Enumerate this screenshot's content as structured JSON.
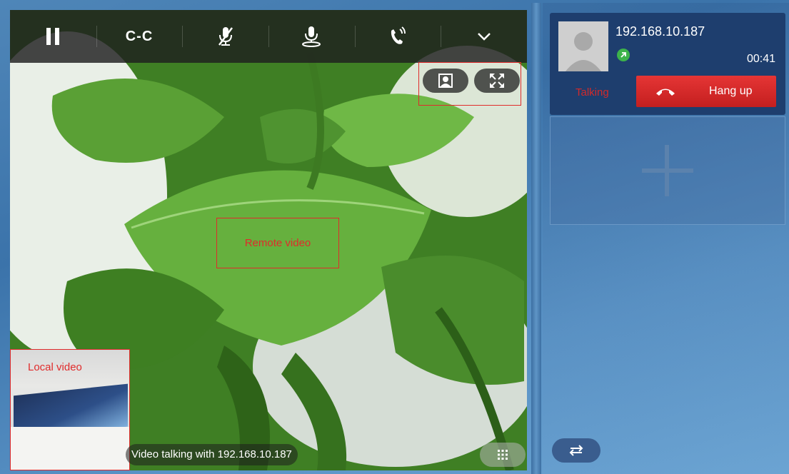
{
  "toolbar": {
    "buttons": [
      {
        "name": "hold",
        "icon": "pause-icon"
      },
      {
        "name": "conference",
        "icon": "conference-icon",
        "label": "C-C"
      },
      {
        "name": "mute",
        "icon": "mic-mute-icon"
      },
      {
        "name": "audio-output",
        "icon": "mic-volume-icon"
      },
      {
        "name": "transfer-call",
        "icon": "call-transfer-icon"
      },
      {
        "name": "more",
        "icon": "chevron-down-icon"
      }
    ]
  },
  "video": {
    "remote_label": "Remote video",
    "local_label": "Local video",
    "status": "Video talking with 192.168.10.187",
    "overlay_buttons": [
      "contact-card-icon",
      "fullscreen-icon"
    ]
  },
  "call": {
    "caller": "192.168.10.187",
    "timer": "00:41",
    "state": "Talking",
    "hangup_label": "Hang up",
    "direction_icon": "outgoing-call-icon"
  },
  "colors": {
    "accent_red": "#e53535",
    "annotation_red": "#e02b2b",
    "card_bg": "#1e3e6e",
    "status_green": "#3db34a"
  }
}
